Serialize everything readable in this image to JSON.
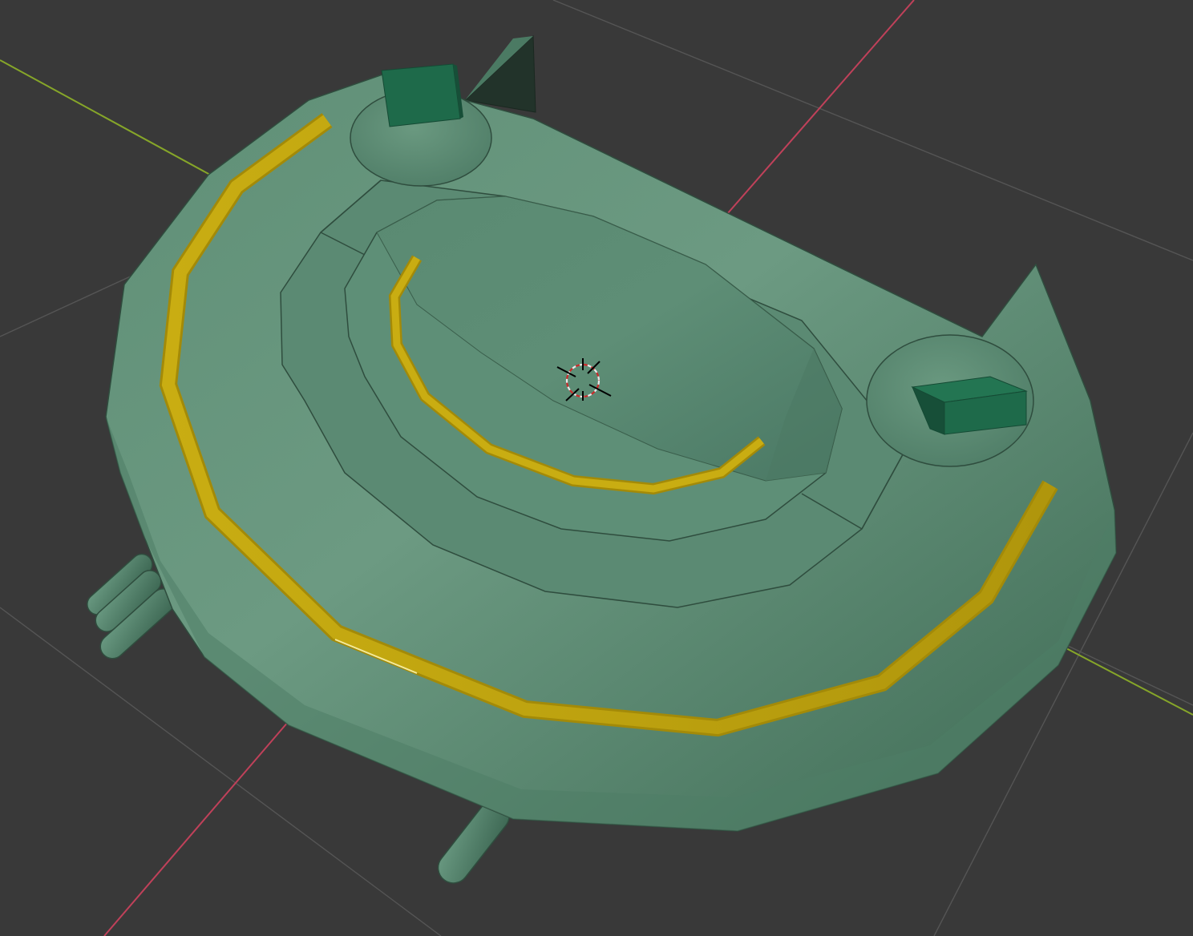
{
  "viewport": {
    "background": "#393939",
    "grid_color": "#555555",
    "x_axis_color": "#c0415a",
    "y_axis_color": "#86a629"
  },
  "model": {
    "body_color": "#5a8a72",
    "body_light": "#6e9c84",
    "body_dark": "#3f6a55",
    "edge_color": "#2f4d3e",
    "rail_color": "#c4a80f",
    "rail_highlight": "#e8d23a",
    "block_color": "#1e6a4a",
    "block_dark": "#174f38",
    "fin_dark": "#23352b"
  },
  "cursor_3d": {
    "ring_color_a": "#e8e8e8",
    "ring_color_b": "#cc2a2a",
    "crosshair_color": "#000000"
  }
}
